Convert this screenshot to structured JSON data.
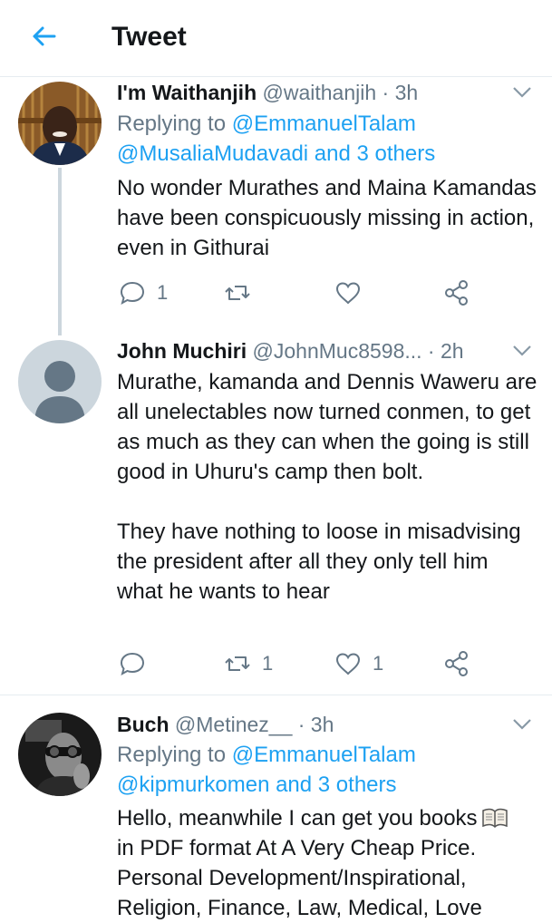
{
  "header": {
    "title": "Tweet",
    "back_icon": "back-arrow-icon"
  },
  "colors": {
    "accent": "#1da1f2",
    "muted": "#657786",
    "text": "#14171a",
    "divider": "#e6ecf0"
  },
  "tweets": [
    {
      "name": "I'm Waithanjih",
      "handle": "@waithanjih",
      "time": "· 3h",
      "replying_to_label": "Replying to",
      "replying_to_user": "@EmmanuelTalam",
      "replying_to_more": "@MusaliaMudavadi and 3 others",
      "body": [
        "No wonder Murathes and Maina Kamandas have been conspicuously missing in action, even in Githurai"
      ],
      "replies": "1",
      "retweets": "",
      "likes": ""
    },
    {
      "name": "John Muchiri",
      "handle": "@JohnMuc8598...",
      "time": "· 2h",
      "body": [
        "Murathe, kamanda and Dennis Waweru are all unelectables now turned conmen, to get as much as they can when the going is still good in Uhuru's camp then bolt.",
        "They have nothing to loose in misadvising the president after all they only tell him what he wants to hear"
      ],
      "replies": "",
      "retweets": "1",
      "likes": "1"
    },
    {
      "name": "Buch",
      "handle": "@Metinez__",
      "time": "· 3h",
      "replying_to_label": "Replying to",
      "replying_to_user": "@EmmanuelTalam",
      "replying_to_more": "@kipmurkomen and 3 others",
      "body": [
        "Hello, meanwhile I can get you books",
        "in PDF format At A Very Cheap Price. Personal Development/Inspirational, Religion, Finance, Law, Medical, Love"
      ]
    }
  ]
}
